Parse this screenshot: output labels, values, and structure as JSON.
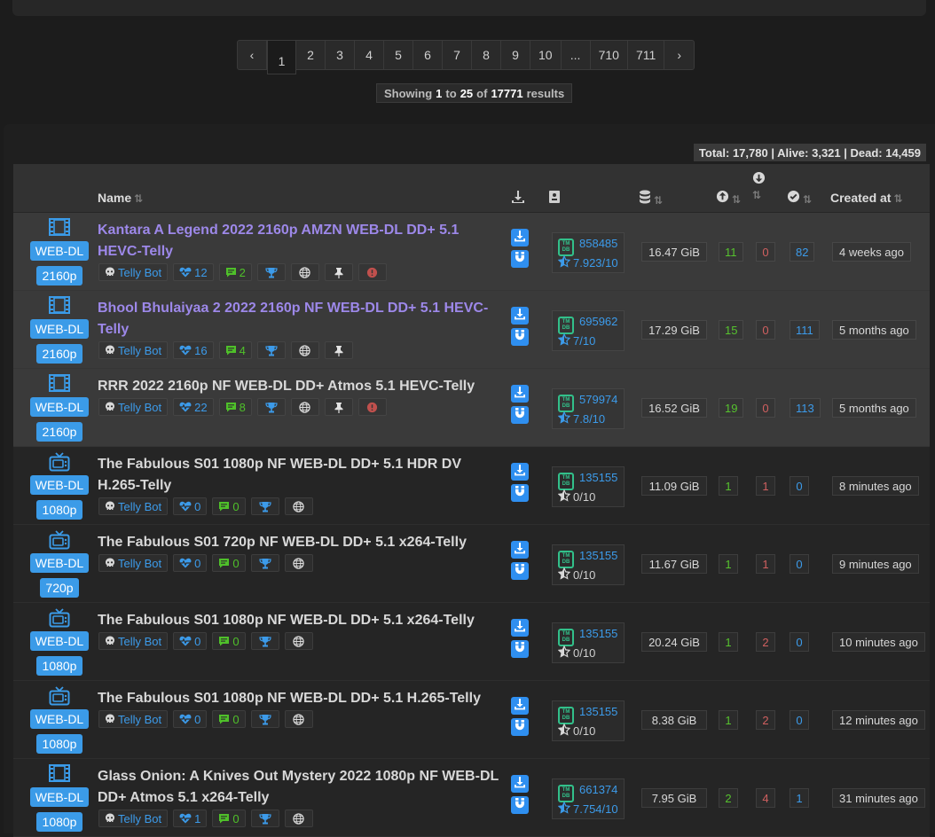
{
  "pagination": {
    "prev": "‹",
    "pages": [
      "1",
      "2",
      "3",
      "4",
      "5",
      "6",
      "7",
      "8",
      "9",
      "10",
      "...",
      "710",
      "711"
    ],
    "next": "›",
    "active": "1"
  },
  "showing": {
    "prefix": "Showing",
    "from": "1",
    "to_word": "to",
    "to": "25",
    "of_word": "of",
    "total": "17771",
    "suffix": "results"
  },
  "totals": "Total: 17,780 | Alive: 3,321 | Dead: 14,459",
  "headers": {
    "name": "Name",
    "created": "Created at"
  },
  "colors": {
    "accent": "#3b9be8",
    "pinned_title": "#9d88e9",
    "seeders": "#56c22e",
    "leechers": "#d06060",
    "tmdb": "#32c08a"
  },
  "tmdb_logo": "TM DB",
  "rows": [
    {
      "cat_icon": "film-icon",
      "cat": "WEB-DL",
      "res": "2160p",
      "title": "Kantara A Legend 2022 2160p AMZN WEB-DL DD+ 5.1 HEVC-Telly",
      "pinned": true,
      "uploader": "Telly Bot",
      "thanks": "12",
      "comments": "2",
      "extra_icons": [
        "trophy-icon",
        "globe-icon",
        "pin-icon",
        "warning-icon"
      ],
      "tmdb_id": "858485",
      "rating": "7.923/10",
      "rated": true,
      "size": "16.47 GiB",
      "seeders": "11",
      "leechers": "0",
      "completed": "82",
      "created": "4 weeks ago"
    },
    {
      "cat_icon": "film-icon",
      "cat": "WEB-DL",
      "res": "2160p",
      "title": "Bhool Bhulaiyaa 2 2022 2160p NF WEB-DL DD+ 5.1 HEVC-Telly",
      "pinned": true,
      "uploader": "Telly Bot",
      "thanks": "16",
      "comments": "4",
      "extra_icons": [
        "trophy-icon",
        "globe-icon",
        "pin-icon"
      ],
      "tmdb_id": "695962",
      "rating": "7/10",
      "rated": true,
      "size": "17.29 GiB",
      "seeders": "15",
      "leechers": "0",
      "completed": "111",
      "created": "5 months ago"
    },
    {
      "cat_icon": "film-icon",
      "cat": "WEB-DL",
      "res": "2160p",
      "title": "RRR 2022 2160p NF WEB-DL DD+ Atmos 5.1 HEVC-Telly",
      "pinned": false,
      "uploader": "Telly Bot",
      "thanks": "22",
      "comments": "8",
      "extra_icons": [
        "trophy-icon",
        "globe-icon",
        "pin-icon",
        "warning-icon"
      ],
      "tmdb_id": "579974",
      "rating": "7.8/10",
      "rated": true,
      "size": "16.52 GiB",
      "seeders": "19",
      "leechers": "0",
      "completed": "113",
      "created": "5 months ago"
    },
    {
      "cat_icon": "tv-icon",
      "cat": "WEB-DL",
      "res": "1080p",
      "title": "The Fabulous S01 1080p NF WEB-DL DD+ 5.1 HDR DV H.265-Telly",
      "pinned": false,
      "uploader": "Telly Bot",
      "thanks": "0",
      "comments": "0",
      "extra_icons": [
        "trophy-icon",
        "globe-icon"
      ],
      "tmdb_id": "135155",
      "rating": "0/10",
      "rated": false,
      "size": "11.09 GiB",
      "seeders": "1",
      "leechers": "1",
      "completed": "0",
      "created": "8 minutes ago"
    },
    {
      "cat_icon": "tv-icon",
      "cat": "WEB-DL",
      "res": "720p",
      "title": "The Fabulous S01 720p NF WEB-DL DD+ 5.1 x264-Telly",
      "pinned": false,
      "uploader": "Telly Bot",
      "thanks": "0",
      "comments": "0",
      "extra_icons": [
        "trophy-icon",
        "globe-icon"
      ],
      "tmdb_id": "135155",
      "rating": "0/10",
      "rated": false,
      "size": "11.67 GiB",
      "seeders": "1",
      "leechers": "1",
      "completed": "0",
      "created": "9 minutes ago"
    },
    {
      "cat_icon": "tv-icon",
      "cat": "WEB-DL",
      "res": "1080p",
      "title": "The Fabulous S01 1080p NF WEB-DL DD+ 5.1 x264-Telly",
      "pinned": false,
      "uploader": "Telly Bot",
      "thanks": "0",
      "comments": "0",
      "extra_icons": [
        "trophy-icon",
        "globe-icon"
      ],
      "tmdb_id": "135155",
      "rating": "0/10",
      "rated": false,
      "size": "20.24 GiB",
      "seeders": "1",
      "leechers": "2",
      "completed": "0",
      "created": "10 minutes ago"
    },
    {
      "cat_icon": "tv-icon",
      "cat": "WEB-DL",
      "res": "1080p",
      "title": "The Fabulous S01 1080p NF WEB-DL DD+ 5.1 H.265-Telly",
      "pinned": false,
      "uploader": "Telly Bot",
      "thanks": "0",
      "comments": "0",
      "extra_icons": [
        "trophy-icon",
        "globe-icon"
      ],
      "tmdb_id": "135155",
      "rating": "0/10",
      "rated": false,
      "size": "8.38 GiB",
      "seeders": "1",
      "leechers": "2",
      "completed": "0",
      "created": "12 minutes ago"
    },
    {
      "cat_icon": "film-icon",
      "cat": "WEB-DL",
      "res": "1080p",
      "title": "Glass Onion: A Knives Out Mystery 2022 1080p NF WEB-DL DD+ Atmos 5.1 x264-Telly",
      "pinned": false,
      "uploader": "Telly Bot",
      "thanks": "1",
      "comments": "0",
      "extra_icons": [
        "trophy-icon",
        "globe-icon"
      ],
      "tmdb_id": "661374",
      "rating": "7.754/10",
      "rated": true,
      "size": "7.95 GiB",
      "seeders": "2",
      "leechers": "4",
      "completed": "1",
      "created": "31 minutes ago"
    }
  ]
}
